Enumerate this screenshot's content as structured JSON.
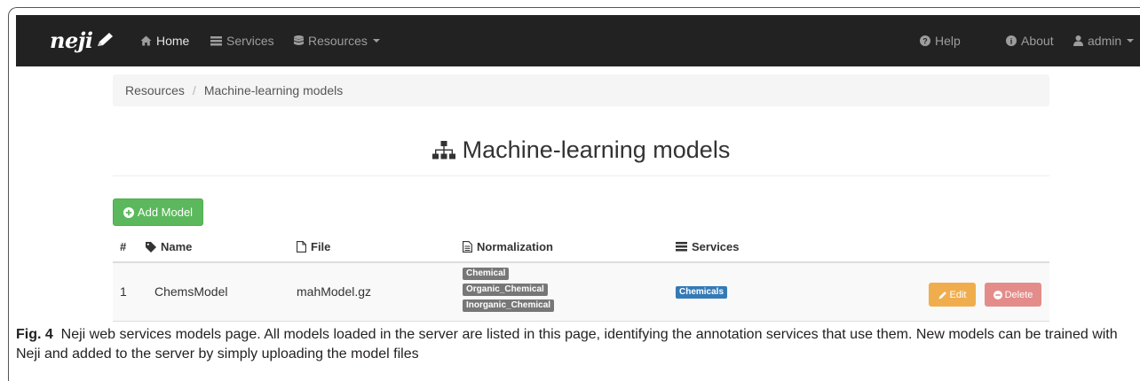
{
  "navbar": {
    "brand": "neji",
    "items": [
      {
        "label": "Home",
        "icon": "home-icon"
      },
      {
        "label": "Services",
        "icon": "list-icon"
      },
      {
        "label": "Resources",
        "icon": "database-icon"
      }
    ],
    "right_items": [
      {
        "label": "Help",
        "icon": "question-circle-icon"
      },
      {
        "label": "About",
        "icon": "info-circle-icon"
      },
      {
        "label": "admin",
        "icon": "user-icon"
      }
    ]
  },
  "breadcrumb": [
    "Resources",
    "Machine-learning models"
  ],
  "breadcrumb_separator": "/",
  "page_title": "Machine-learning models",
  "add_button": "Add Model",
  "table": {
    "headers": [
      "#",
      "Name",
      "File",
      "Normalization",
      "Services"
    ],
    "rows": [
      {
        "index": "1",
        "name": "ChemsModel",
        "file": "mahModel.gz",
        "normalization": [
          "Chemical",
          "Organic_Chemical",
          "Inorganic_Chemical"
        ],
        "services": [
          "Chemicals"
        ],
        "edit_label": "Edit",
        "delete_label": "Delete"
      }
    ]
  },
  "caption": {
    "label": "Fig. 4",
    "text": "Neji web services models page. All models loaded in the server are listed in this page, identifying the annotation services that use them. New models can be trained with Neji and added to the server by simply uploading the model files"
  },
  "colors": {
    "navbar": "#222222",
    "success": "#5cb85c",
    "warning": "#f0ad4e",
    "danger": "#d9534f",
    "primary": "#337ab7",
    "label_default": "#777777"
  }
}
